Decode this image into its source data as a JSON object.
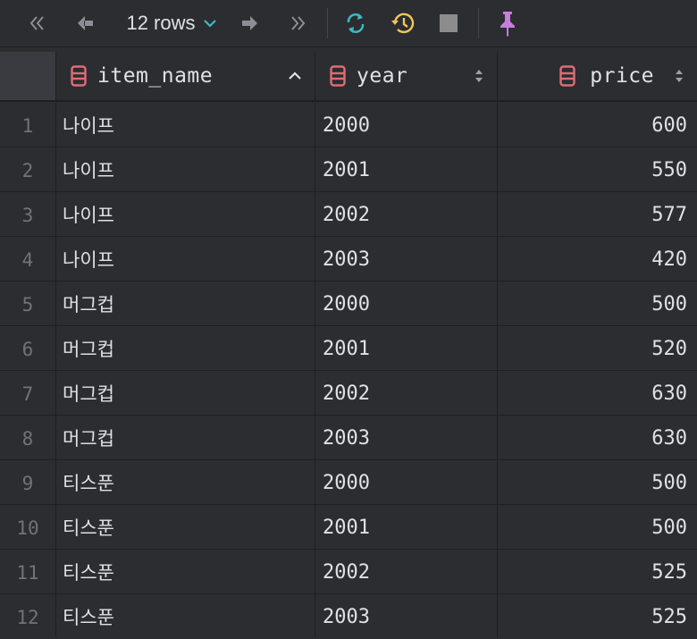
{
  "toolbar": {
    "rows_label": "12 rows",
    "icons": [
      "first-page-icon",
      "previous-page-icon",
      "rows-dropdown-chevron-icon",
      "next-page-icon",
      "last-page-icon",
      "refresh-icon",
      "history-icon",
      "stop-icon",
      "pin-icon"
    ],
    "colors": {
      "refresh": "#3fb9c7",
      "history": "#f2c55c",
      "stop": "#8c8c8c",
      "pin": "#c77dde",
      "chevron": "#3fb9c7"
    }
  },
  "columns": [
    {
      "name": "item_name",
      "sort_icon": "sort-ascending-icon"
    },
    {
      "name": "year",
      "sort_icon": "sort-both-icon"
    },
    {
      "name": "price",
      "sort_icon": "sort-both-icon"
    }
  ],
  "rows": [
    {
      "num": "1",
      "item_name": "나이프",
      "year": "2000",
      "price": "600"
    },
    {
      "num": "2",
      "item_name": "나이프",
      "year": "2001",
      "price": "550"
    },
    {
      "num": "3",
      "item_name": "나이프",
      "year": "2002",
      "price": "577"
    },
    {
      "num": "4",
      "item_name": "나이프",
      "year": "2003",
      "price": "420"
    },
    {
      "num": "5",
      "item_name": "머그컵",
      "year": "2000",
      "price": "500"
    },
    {
      "num": "6",
      "item_name": "머그컵",
      "year": "2001",
      "price": "520"
    },
    {
      "num": "7",
      "item_name": "머그컵",
      "year": "2002",
      "price": "630"
    },
    {
      "num": "8",
      "item_name": "머그컵",
      "year": "2003",
      "price": "630"
    },
    {
      "num": "9",
      "item_name": "티스푼",
      "year": "2000",
      "price": "500"
    },
    {
      "num": "10",
      "item_name": "티스푼",
      "year": "2001",
      "price": "500"
    },
    {
      "num": "11",
      "item_name": "티스푼",
      "year": "2002",
      "price": "525"
    },
    {
      "num": "12",
      "item_name": "티스푼",
      "year": "2003",
      "price": "525"
    }
  ]
}
